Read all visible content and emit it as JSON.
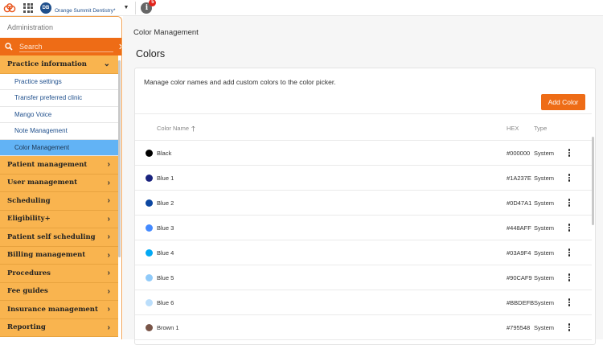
{
  "topbar": {
    "avatar_initials": "DB",
    "practice_name": "Orange Summit Dentistry*",
    "notification_count": "5",
    "info_icon": "i"
  },
  "sidebar": {
    "title": "Administration",
    "search_placeholder": "Search",
    "groups": [
      {
        "label": "Practice information",
        "expanded": true
      },
      {
        "label": "Patient management"
      },
      {
        "label": "User management"
      },
      {
        "label": "Scheduling"
      },
      {
        "label": "Eligibility+"
      },
      {
        "label": "Patient self scheduling"
      },
      {
        "label": "Billing management"
      },
      {
        "label": "Procedures"
      },
      {
        "label": "Fee guides"
      },
      {
        "label": "Insurance management"
      },
      {
        "label": "Reporting"
      }
    ],
    "subitems": [
      {
        "label": "Practice settings"
      },
      {
        "label": "Transfer preferred clinic"
      },
      {
        "label": "Mango Voice"
      },
      {
        "label": "Note Management"
      },
      {
        "label": "Color Management",
        "active": true
      }
    ]
  },
  "main": {
    "breadcrumb": "Color Management",
    "heading": "Colors",
    "description": "Manage color names and add custom colors to the color picker.",
    "add_button": "Add Color",
    "columns": {
      "name": "Color Name",
      "hex": "HEX",
      "type": "Type"
    },
    "colors": [
      {
        "name": "Black",
        "hex": "#000000",
        "type": "System"
      },
      {
        "name": "Blue 1",
        "hex": "#1A237E",
        "type": "System"
      },
      {
        "name": "Blue 2",
        "hex": "#0D47A1",
        "type": "System"
      },
      {
        "name": "Blue 3",
        "hex": "#448AFF",
        "type": "System"
      },
      {
        "name": "Blue 4",
        "hex": "#03A9F4",
        "type": "System"
      },
      {
        "name": "Blue 5",
        "hex": "#90CAF9",
        "type": "System"
      },
      {
        "name": "Blue 6",
        "hex": "#BBDEFB",
        "type": "System"
      },
      {
        "name": "Brown 1",
        "hex": "#795548",
        "type": "System"
      }
    ]
  },
  "colors": {
    "accent": "#ee6c16",
    "sidebar_group": "#f9b44f",
    "active_item": "#62b3f5",
    "link": "#1f4f8c"
  }
}
